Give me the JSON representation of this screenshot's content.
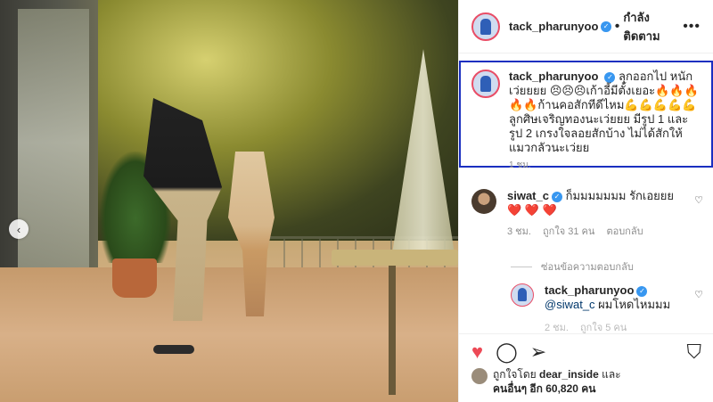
{
  "post": {
    "author": "tack_pharunyoo",
    "follow_state": "กำลังติดตาม",
    "separator": "•",
    "more_icon": "more-icon"
  },
  "caption": {
    "username": "tack_pharunyoo",
    "text": "ลุกออกไป หนักเว่ยยยย 😣😣😣เก้าอี้มีตั้งเยอะ🔥🔥🔥🔥🔥ก้านคอสักทีดีไหม💪💪💪💪💪ลูกศิษเจริญทองนะเว่ยยย มีรูป 1 และ รูป 2 เกรงใจลอยสักบ้าง ไม่ได้สักให้แมวกลัวนะเว่ยย",
    "time": "1 ชม."
  },
  "comments": [
    {
      "username": "siwat_c",
      "text": "ก็มมมมมมม รักเอยยย",
      "hearts": "❤️ ❤️ ❤️",
      "time": "3 ชม.",
      "likes": "ถูกใจ 31 คน",
      "reply": "ตอบกลับ"
    },
    {
      "username": "tack_pharunyoo",
      "mention": "@siwat_c",
      "text": "ผมโหดไหมมม",
      "time": "2 ชม.",
      "likes": "ถูกใจ 5 คน"
    }
  ],
  "replies_toggle": "ซ่อนข้อความตอบกลับ",
  "liked_by": {
    "prefix": "ถูกใจโดย",
    "user": "dear_inside",
    "suffix": "และ",
    "others": "คนอื่นๆ อีก 60,820 คน"
  },
  "colors": {
    "highlight_border": "#1a2fc0",
    "like_red": "#ed4956",
    "verified_blue": "#3897f0"
  }
}
